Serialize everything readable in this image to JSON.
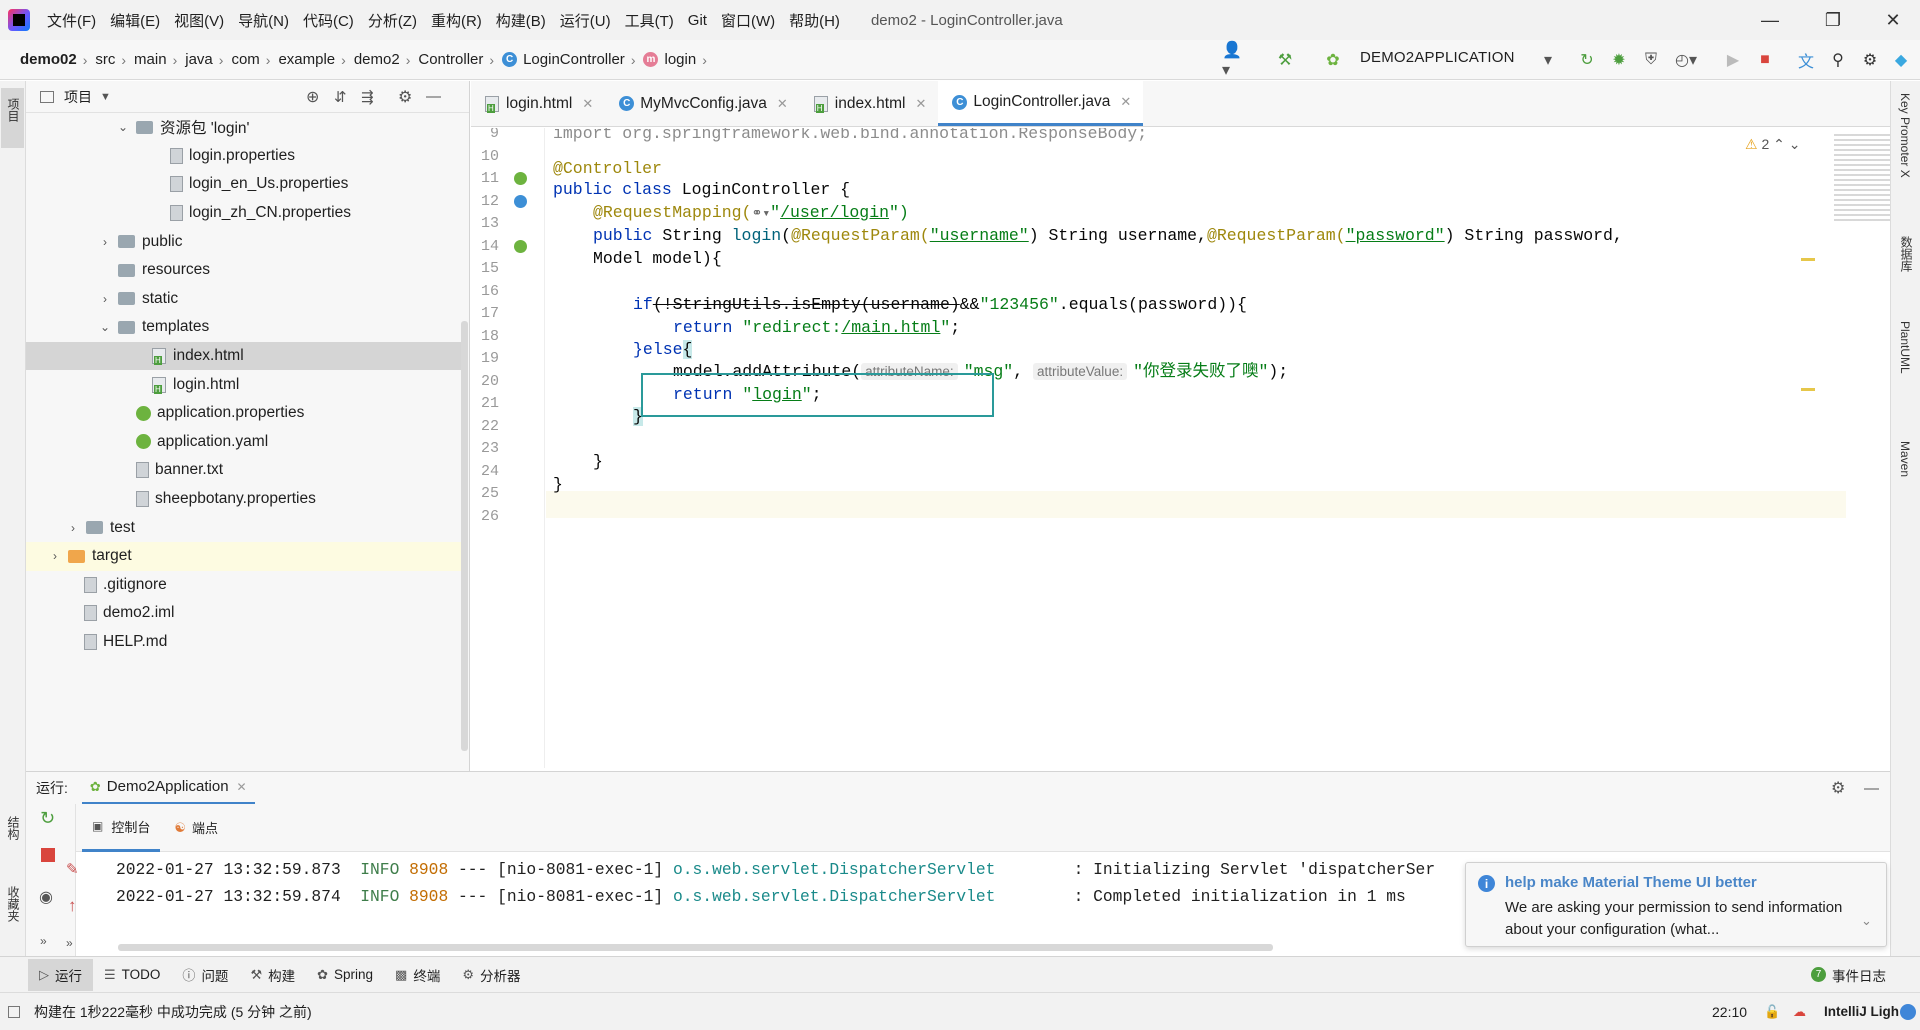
{
  "menubar": {
    "items": [
      "文件(F)",
      "编辑(E)",
      "视图(V)",
      "导航(N)",
      "代码(C)",
      "分析(Z)",
      "重构(R)",
      "构建(B)",
      "运行(U)",
      "工具(T)",
      "Git",
      "窗口(W)",
      "帮助(H)"
    ],
    "window_title": "demo2 - LoginController.java"
  },
  "breadcrumb": {
    "items": [
      "demo02",
      "src",
      "main",
      "java",
      "com",
      "example",
      "demo2",
      "Controller"
    ],
    "class_name": "LoginController",
    "method_name": "login"
  },
  "run_config": {
    "name": "DEMO2APPLICATION"
  },
  "left_strip": {
    "project_label": "项目",
    "structure_label": "结构",
    "bookmarks_label": "收藏夹"
  },
  "project_panel": {
    "title": "项目",
    "tree": [
      {
        "label": "资源包 'login'",
        "type": "bundle",
        "chev": "v"
      },
      {
        "label": "login.properties",
        "type": "file"
      },
      {
        "label": "login_en_Us.properties",
        "type": "file"
      },
      {
        "label": "login_zh_CN.properties",
        "type": "file"
      },
      {
        "label": "public",
        "type": "folder",
        "chev": ">"
      },
      {
        "label": "resources",
        "type": "folder"
      },
      {
        "label": "static",
        "type": "folder",
        "chev": ">"
      },
      {
        "label": "templates",
        "type": "folder",
        "chev": "v"
      },
      {
        "label": "index.html",
        "type": "html",
        "selected": true
      },
      {
        "label": "login.html",
        "type": "html"
      },
      {
        "label": "application.properties",
        "type": "spring"
      },
      {
        "label": "application.yaml",
        "type": "spring"
      },
      {
        "label": "banner.txt",
        "type": "file"
      },
      {
        "label": "sheepbotany.properties",
        "type": "file"
      },
      {
        "label": "test",
        "type": "folder",
        "chev": ">"
      },
      {
        "label": "target",
        "type": "folder-orange",
        "chev": ">"
      },
      {
        "label": ".gitignore",
        "type": "file"
      },
      {
        "label": "demo2.iml",
        "type": "file"
      },
      {
        "label": "HELP.md",
        "type": "file"
      }
    ]
  },
  "editor_tabs": [
    {
      "label": "login.html",
      "type": "html"
    },
    {
      "label": "MyMvcConfig.java",
      "type": "class"
    },
    {
      "label": "index.html",
      "type": "html"
    },
    {
      "label": "LoginController.java",
      "type": "class",
      "active": true
    }
  ],
  "editor": {
    "warnings_count": "2",
    "line_numbers": [
      "9",
      "10",
      "11",
      "12",
      "13",
      "14",
      "15",
      "16",
      "17",
      "18",
      "19",
      "20",
      "21",
      "22",
      "23",
      "24",
      "25",
      "26"
    ],
    "code": {
      "l9": "import org.springframework.web.bind.annotation.ResponseBody;",
      "l11": "@Controller",
      "l12_kw": "public class",
      "l12_rest": " LoginController {",
      "l13_ann": "@RequestMapping(",
      "l13_str_open": "\"",
      "l13_path": "/user/login",
      "l13_close": "\")",
      "l14_kw": "public",
      "l14_a": " String ",
      "l14_method": "login",
      "l14_b": "(",
      "l14_ann1": "@RequestParam(",
      "l14_str1": "\"username\"",
      "l14_c": ") String username,",
      "l14_ann2": "@RequestParam(",
      "l14_str2": "\"password\"",
      "l14_d": ") String password,",
      "l15": "Model model){",
      "l17_kw": "if",
      "l17_strike": "(!StringUtils.isEmpty(username)",
      "l17_and": "&&",
      "l17_str": "\"123456\"",
      "l17_rest": ".equals(password)){",
      "l18_kw": "return",
      "l18_str_open": " \"redirect:",
      "l18_link": "/main.html",
      "l18_str_close": "\"",
      "l18_semi": ";",
      "l19": "}else",
      "l19_brace": "{",
      "l20_a": "model.addAttribute(",
      "l20_hint1": "attributeName:",
      "l20_str1": "\"msg\"",
      "l20_comma": ",",
      "l20_hint2": "attributeValue:",
      "l20_str2": "\"你登录失败了噢\"",
      "l20_end": ");",
      "l21_kw": "return",
      "l21_str_open": " \"",
      "l21_link": "login",
      "l21_str_close": "\"",
      "l21_semi": ";",
      "l22": "}",
      "l24": "}",
      "l25": "}"
    }
  },
  "run_panel": {
    "label": "运行:",
    "tab": "Demo2Application",
    "subtabs": [
      "控制台",
      "端点"
    ],
    "logs": [
      {
        "ts": "2022-01-27 13:32:59.873",
        "level": "INFO",
        "pid": "8908",
        "sep": "---",
        "thread": "[nio-8081-exec-1]",
        "logger": "o.s.web.servlet.DispatcherServlet",
        "msg": ": Initializing Servlet 'dispatcherSer"
      },
      {
        "ts": "2022-01-27 13:32:59.874",
        "level": "INFO",
        "pid": "8908",
        "sep": "---",
        "thread": "[nio-8081-exec-1]",
        "logger": "o.s.web.servlet.DispatcherServlet",
        "msg": ": Completed initialization in 1 ms"
      }
    ]
  },
  "notification": {
    "title": "help make Material Theme UI better",
    "body": "We are asking your permission to send information about your configuration (what..."
  },
  "tool_windows": [
    "运行",
    "TODO",
    "问题",
    "构建",
    "Spring",
    "终端",
    "分析器"
  ],
  "event_log": {
    "count": "7",
    "label": "事件日志"
  },
  "status": {
    "message": "构建在 1秒222毫秒 中成功完成 (5 分钟 之前)",
    "position": "22:10",
    "theme": "IntelliJ Ligh"
  },
  "right_strip": {
    "labels": [
      "Key Promoter X",
      "数据库",
      "PlantUML",
      "Maven"
    ]
  },
  "colors": {
    "accent": "#4083c9",
    "highlight_box": "#2a9a9a",
    "keyword": "#0033b3",
    "string": "#067d17",
    "annotation": "#9e880d"
  }
}
